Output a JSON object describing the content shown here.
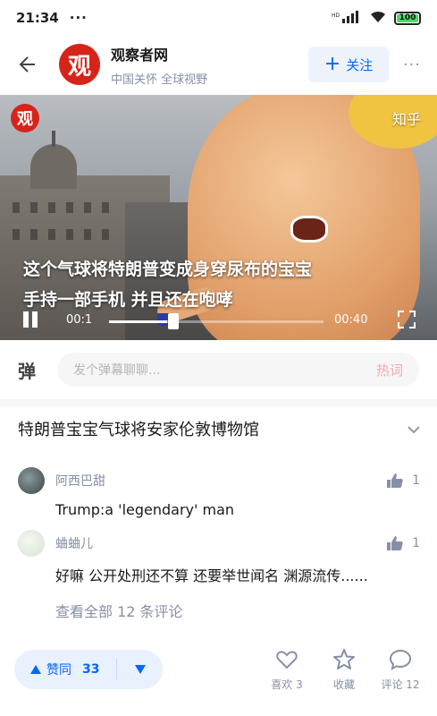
{
  "status": {
    "time": "21:34",
    "dots": "···",
    "signal": "HD",
    "battery": "100"
  },
  "header": {
    "back_icon": "arrow-left-icon",
    "logo_char": "观",
    "name": "观察者网",
    "desc": "中国关怀 全球视野",
    "follow_label": "关注",
    "more": "···"
  },
  "video": {
    "watermark_logo": "观",
    "watermark": "知乎",
    "caption_line1": "这个气球将特朗普变成身穿尿布的宝宝",
    "caption_line2": "手持一部手机 并且还在咆哮",
    "current_time": "00:1",
    "total_time": "00:40",
    "progress": 0.27
  },
  "danmu": {
    "icon": "弹",
    "placeholder": "发个弹幕聊聊...",
    "hot": "热词"
  },
  "article": {
    "title": "特朗普宝宝气球将安家伦敦博物馆"
  },
  "comments": [
    {
      "name": "阿西巴甜",
      "text": "Trump:a 'legendary' man",
      "likes": "1"
    },
    {
      "name": "蛐蛐儿",
      "text": "好嘛 公开处刑还不算 还要举世闻名 渊源流传......",
      "likes": "1"
    }
  ],
  "see_all": "查看全部 12 条评论",
  "bottom": {
    "vote_label": "赞同",
    "vote_count": "33",
    "like_label": "喜欢 3",
    "collect_label": "收藏",
    "comment_label": "评论 12"
  },
  "colors": {
    "accent": "#0066ff",
    "brand_red": "#d7241a",
    "muted": "#8590a6"
  }
}
